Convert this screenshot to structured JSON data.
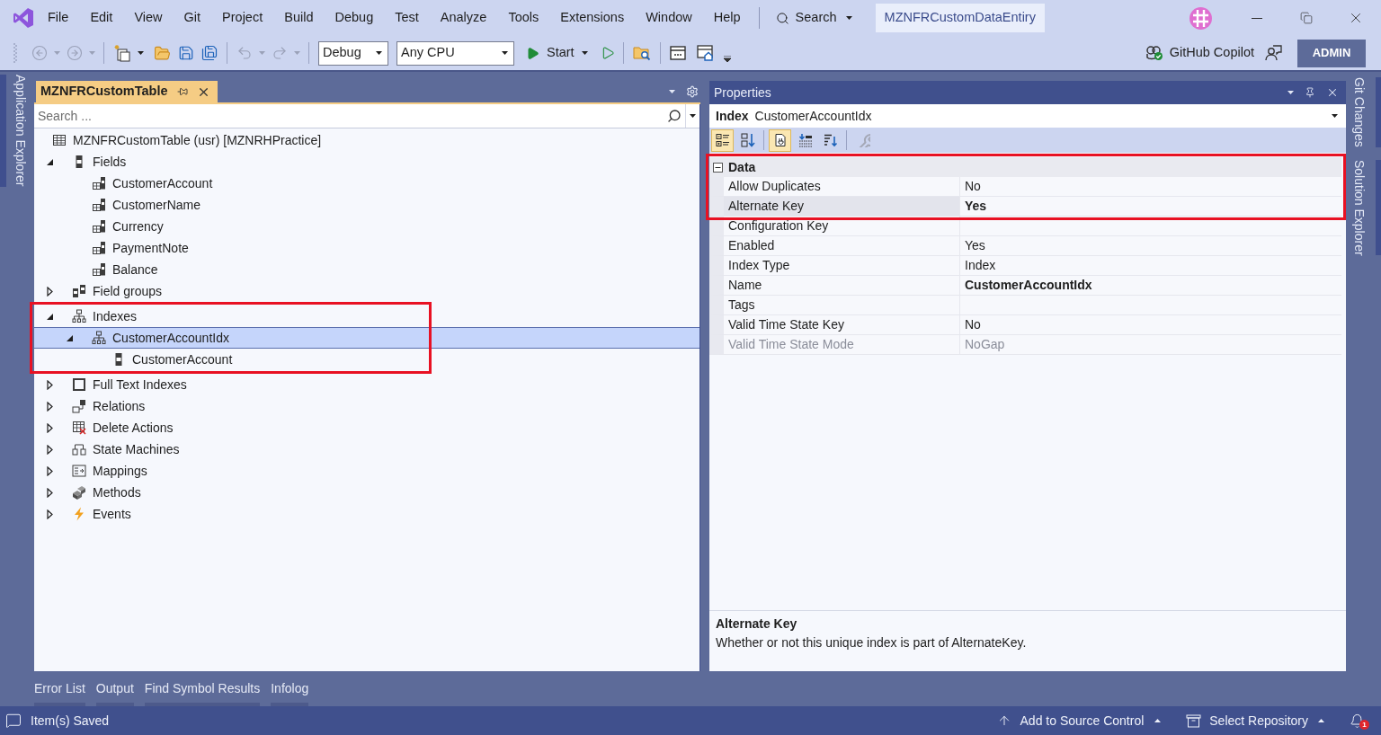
{
  "menu_bar": {
    "items": [
      "File",
      "Edit",
      "View",
      "Git",
      "Project",
      "Build",
      "Debug",
      "Test",
      "Analyze",
      "Tools",
      "Extensions",
      "Window",
      "Help"
    ],
    "search": "Search",
    "solution_name": "MZNFRCustomDataEntiry"
  },
  "toolbar": {
    "history": [
      {
        "kind": "back",
        "disabled": true
      },
      {
        "kind": "forward",
        "disabled": true
      }
    ],
    "edit_history": [
      {
        "kind": "undo",
        "disabled": true
      },
      {
        "kind": "redo",
        "disabled": true
      }
    ],
    "configuration": "Debug",
    "platform": "Any CPU",
    "start": "Start",
    "copilot": "GitHub Copilot",
    "account": "ADMIN"
  },
  "side_tabs_left": [
    "Application Explorer"
  ],
  "side_tabs_right": [
    "Git Changes",
    "Solution Explorer"
  ],
  "designer": {
    "tab": "MZNFRCustomTable",
    "search": {
      "placeholder": "Search ..."
    },
    "tree": {
      "label": "MZNFRCustomTable (usr) [MZNRHPractice]",
      "kind": "table",
      "selected": false,
      "children": [
        {
          "label": "Fields",
          "kind": "fields",
          "expanded": true,
          "selected": false,
          "highlighted": false,
          "children": [
            {
              "label": "CustomerAccount",
              "kind": "field",
              "selected": false
            },
            {
              "label": "CustomerName",
              "kind": "field",
              "selected": false
            },
            {
              "label": "Currency",
              "kind": "field",
              "selected": false
            },
            {
              "label": "PaymentNote",
              "kind": "field",
              "selected": false
            },
            {
              "label": "Balance",
              "kind": "field",
              "selected": false
            }
          ]
        },
        {
          "label": "Field groups",
          "kind": "field_groups",
          "expanded": false,
          "selected": false,
          "highlighted": false
        },
        {
          "label": "Indexes",
          "kind": "indexes",
          "expanded": true,
          "selected": false,
          "highlighted": true,
          "children": [
            {
              "label": "CustomerAccountIdx",
              "kind": "index",
              "expanded": true,
              "selected": true,
              "children": [
                {
                  "label": "CustomerAccount",
                  "kind": "index_field",
                  "selected": false
                }
              ]
            }
          ]
        },
        {
          "label": "Full Text Indexes",
          "kind": "full_text_indexes",
          "expanded": false,
          "selected": false,
          "highlighted": false
        },
        {
          "label": "Relations",
          "kind": "relations",
          "expanded": false,
          "selected": false,
          "highlighted": false
        },
        {
          "label": "Delete Actions",
          "kind": "delete_actions",
          "expanded": false,
          "selected": false,
          "highlighted": false
        },
        {
          "label": "State Machines",
          "kind": "state_machines",
          "expanded": false,
          "selected": false,
          "highlighted": false
        },
        {
          "label": "Mappings",
          "kind": "mappings",
          "expanded": false,
          "selected": false,
          "highlighted": false
        },
        {
          "label": "Methods",
          "kind": "methods",
          "expanded": false,
          "selected": false,
          "highlighted": false
        },
        {
          "label": "Events",
          "kind": "events",
          "expanded": false,
          "selected": false,
          "highlighted": false
        }
      ]
    }
  },
  "properties": {
    "title": "Properties",
    "object": {
      "type": "Index",
      "name": "CustomerAccountIdx"
    },
    "toolbar": [
      {
        "kind": "categorized",
        "selected": true,
        "disabled": false
      },
      {
        "kind": "alphabetical",
        "selected": false,
        "disabled": false
      },
      {
        "kind": "property_pages",
        "selected": true,
        "disabled": false
      },
      {
        "kind": "events",
        "selected": false,
        "disabled": false
      },
      {
        "kind": "sort",
        "selected": false,
        "disabled": false
      },
      {
        "kind": "settings",
        "selected": false,
        "disabled": true
      }
    ],
    "categories": [
      {
        "name": "Data",
        "expanded": true,
        "highlighted": true,
        "rows": [
          {
            "name": "Allow Duplicates",
            "value": "No",
            "selected": false,
            "changed": false,
            "disabled": false,
            "highlighted": true
          },
          {
            "name": "Alternate Key",
            "value": "Yes",
            "selected": true,
            "changed": true,
            "disabled": false,
            "highlighted": true
          },
          {
            "name": "Configuration Key",
            "selected": false,
            "disabled": false,
            "highlighted": false
          },
          {
            "name": "Enabled",
            "value": "Yes",
            "selected": false,
            "changed": false,
            "disabled": false,
            "highlighted": false
          },
          {
            "name": "Index Type",
            "value": "Index",
            "selected": false,
            "changed": false,
            "disabled": false,
            "highlighted": false
          },
          {
            "name": "Name",
            "value": "CustomerAccountIdx",
            "selected": false,
            "changed": true,
            "disabled": false,
            "highlighted": false
          },
          {
            "name": "Tags",
            "selected": false,
            "disabled": false,
            "highlighted": false
          },
          {
            "name": "Valid Time State Key",
            "value": "No",
            "selected": false,
            "changed": false,
            "disabled": false,
            "highlighted": false
          },
          {
            "name": "Valid Time State Mode",
            "value": "NoGap",
            "selected": false,
            "changed": false,
            "disabled": true,
            "highlighted": false
          }
        ]
      }
    ],
    "description": {
      "title": "Alternate Key",
      "text": "Whether or not this unique index is part of AlternateKey."
    }
  },
  "bottom_tabs": [
    "Error List",
    "Output",
    "Find Symbol Results",
    "Infolog"
  ],
  "status_bar": {
    "message": "Item(s) Saved",
    "source_control": "Add to Source Control",
    "repository": "Select Repository",
    "notification_count": "1"
  }
}
